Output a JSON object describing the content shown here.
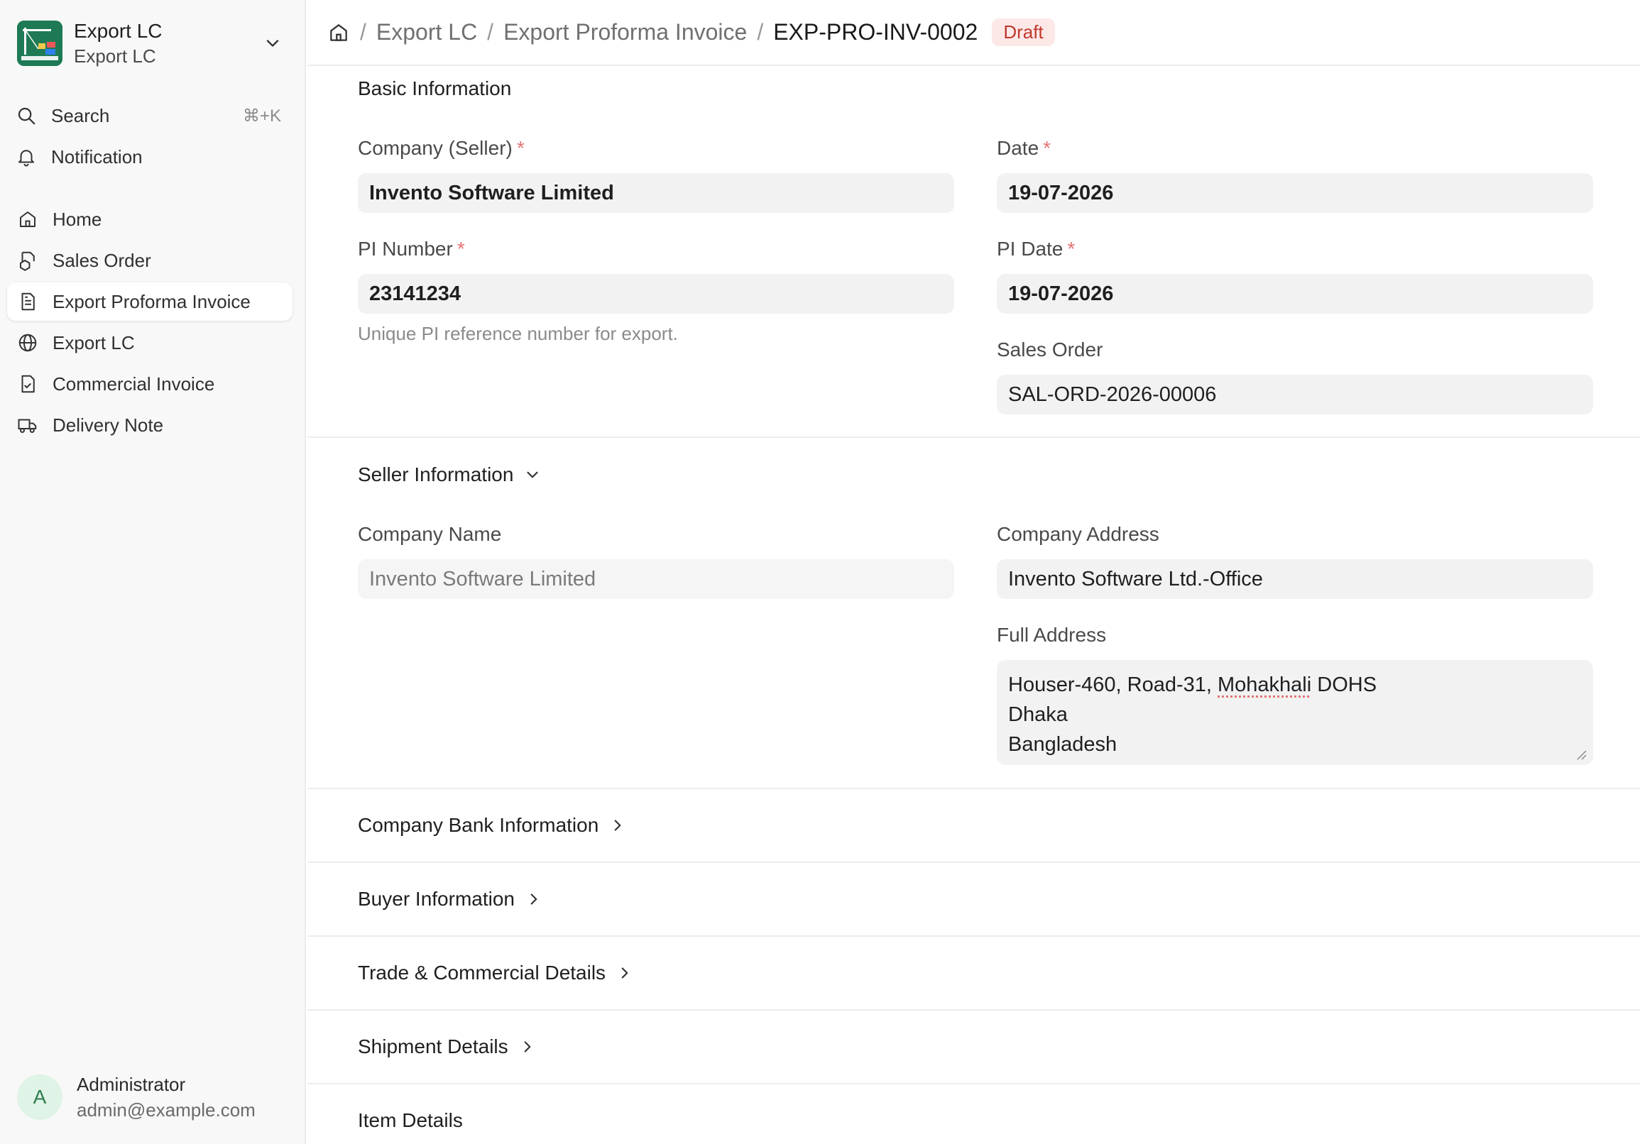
{
  "sidebar": {
    "brand_title": "Export LC",
    "brand_subtitle": "Export LC",
    "search_label": "Search",
    "search_shortcut": "⌘+K",
    "notification_label": "Notification",
    "nav": [
      {
        "label": "Home",
        "icon": "home-icon"
      },
      {
        "label": "Sales Order",
        "icon": "sales-order-icon"
      },
      {
        "label": "Export Proforma Invoice",
        "icon": "document-icon",
        "active": true
      },
      {
        "label": "Export LC",
        "icon": "globe-icon"
      },
      {
        "label": "Commercial Invoice",
        "icon": "invoice-check-icon"
      },
      {
        "label": "Delivery Note",
        "icon": "truck-icon"
      }
    ],
    "user": {
      "initial": "A",
      "name": "Administrator",
      "email": "admin@example.com"
    }
  },
  "header": {
    "breadcrumbs": [
      "Export LC",
      "Export Proforma Invoice"
    ],
    "current": "EXP-PRO-INV-0002",
    "status": "Draft"
  },
  "basic": {
    "title": "Basic Information",
    "company_label": "Company (Seller)",
    "company_value": "Invento Software Limited",
    "date_label": "Date",
    "date_value": "19-07-2026",
    "pi_number_label": "PI Number",
    "pi_number_value": "23141234",
    "pi_number_help": "Unique PI reference number for export.",
    "pi_date_label": "PI Date",
    "pi_date_value": "19-07-2026",
    "sales_order_label": "Sales Order",
    "sales_order_value": "SAL-ORD-2026-00006"
  },
  "seller": {
    "title": "Seller Information",
    "company_name_label": "Company Name",
    "company_name_value": "Invento Software Limited",
    "company_address_label": "Company Address",
    "company_address_value": "Invento Software Ltd.-Office",
    "full_address_label": "Full Address",
    "full_address_line1_a": "Houser-460, Road-31, ",
    "full_address_line1_b": "Mohakhali",
    "full_address_line1_c": " DOHS",
    "full_address_line2": "Dhaka",
    "full_address_line3": "Bangladesh"
  },
  "collapsed_sections": [
    "Company Bank Information",
    "Buyer Information",
    "Trade & Commercial Details",
    "Shipment Details"
  ],
  "item_details_title": "Item Details",
  "colors": {
    "accent": "#1e7a55",
    "draft_bg": "#fde8e8",
    "draft_text": "#c0392b",
    "required": "#e57373"
  }
}
